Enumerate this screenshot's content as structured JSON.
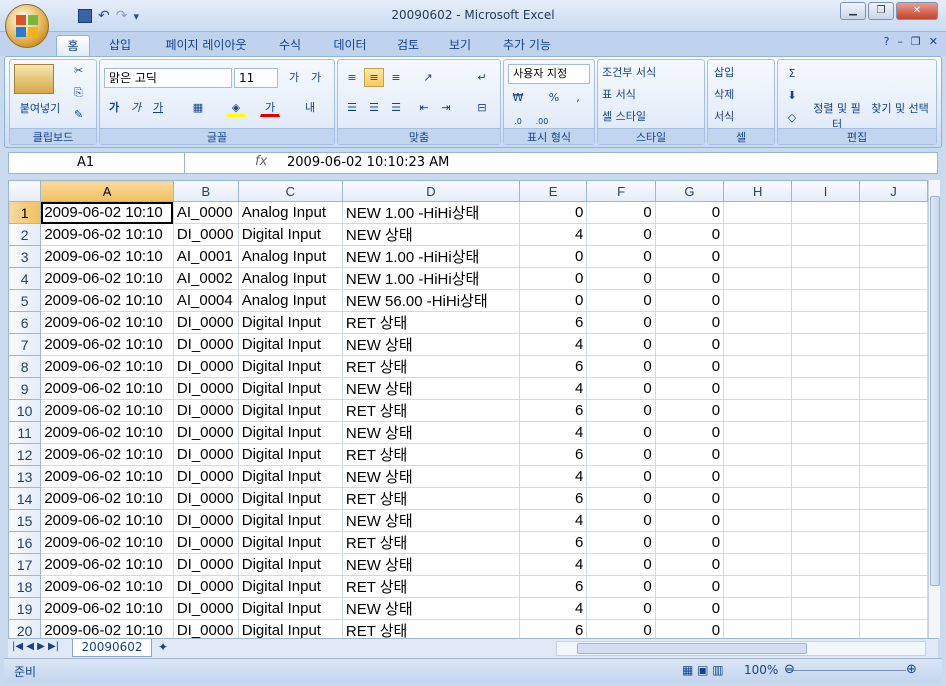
{
  "window": {
    "title": "20090602 - Microsoft Excel",
    "minimize": "▁",
    "restore": "❐",
    "close": "✕"
  },
  "ribbon_tabs": [
    "홈",
    "삽입",
    "페이지 레이아웃",
    "수식",
    "데이터",
    "검토",
    "보기",
    "추가 기능"
  ],
  "ribbon": {
    "clipboard": {
      "label": "클립보드",
      "paste": "붙여넣기"
    },
    "font": {
      "label": "글꼴",
      "name": "맑은 고딕",
      "size": "11"
    },
    "alignment": {
      "label": "맞춤"
    },
    "number": {
      "label": "표시 형식",
      "format": "사용자 지정"
    },
    "styles": {
      "label": "스타일",
      "conditional": "조건부 서식",
      "table": "표 서식",
      "cell": "셀 스타일"
    },
    "cells": {
      "label": "셀",
      "insert": "삽입",
      "delete": "삭제",
      "format": "서식"
    },
    "editing": {
      "label": "편집",
      "sort": "정렬 및 필터",
      "find": "찾기 및 선택"
    }
  },
  "formula_bar": {
    "name_box": "A1",
    "fx": "fx",
    "value": "2009-06-02  10:10:23 AM"
  },
  "columns": [
    "A",
    "B",
    "C",
    "D",
    "E",
    "F",
    "G",
    "H",
    "I",
    "J"
  ],
  "rows": [
    [
      "1",
      "2009-06-02 10:10",
      "AI_0000",
      "Analog Input",
      "NEW  1.00  -HiHi상태",
      "0",
      "0",
      "0"
    ],
    [
      "2",
      "2009-06-02 10:10",
      "DI_0000",
      "Digital Input",
      "NEW   상태",
      "4",
      "0",
      "0"
    ],
    [
      "3",
      "2009-06-02 10:10",
      "AI_0001",
      "Analog Input",
      "NEW  1.00  -HiHi상태",
      "0",
      "0",
      "0"
    ],
    [
      "4",
      "2009-06-02 10:10",
      "AI_0002",
      "Analog Input",
      "NEW  1.00  -HiHi상태",
      "0",
      "0",
      "0"
    ],
    [
      "5",
      "2009-06-02 10:10",
      "AI_0004",
      "Analog Input",
      "NEW  56.00  -HiHi상태",
      "0",
      "0",
      "0"
    ],
    [
      "6",
      "2009-06-02 10:10",
      "DI_0000",
      "Digital Input",
      "RET   상태",
      "6",
      "0",
      "0"
    ],
    [
      "7",
      "2009-06-02 10:10",
      "DI_0000",
      "Digital Input",
      "NEW   상태",
      "4",
      "0",
      "0"
    ],
    [
      "8",
      "2009-06-02 10:10",
      "DI_0000",
      "Digital Input",
      "RET   상태",
      "6",
      "0",
      "0"
    ],
    [
      "9",
      "2009-06-02 10:10",
      "DI_0000",
      "Digital Input",
      "NEW   상태",
      "4",
      "0",
      "0"
    ],
    [
      "10",
      "2009-06-02 10:10",
      "DI_0000",
      "Digital Input",
      "RET   상태",
      "6",
      "0",
      "0"
    ],
    [
      "11",
      "2009-06-02 10:10",
      "DI_0000",
      "Digital Input",
      "NEW   상태",
      "4",
      "0",
      "0"
    ],
    [
      "12",
      "2009-06-02 10:10",
      "DI_0000",
      "Digital Input",
      "RET   상태",
      "6",
      "0",
      "0"
    ],
    [
      "13",
      "2009-06-02 10:10",
      "DI_0000",
      "Digital Input",
      "NEW   상태",
      "4",
      "0",
      "0"
    ],
    [
      "14",
      "2009-06-02 10:10",
      "DI_0000",
      "Digital Input",
      "RET   상태",
      "6",
      "0",
      "0"
    ],
    [
      "15",
      "2009-06-02 10:10",
      "DI_0000",
      "Digital Input",
      "NEW   상태",
      "4",
      "0",
      "0"
    ],
    [
      "16",
      "2009-06-02 10:10",
      "DI_0000",
      "Digital Input",
      "RET   상태",
      "6",
      "0",
      "0"
    ],
    [
      "17",
      "2009-06-02 10:10",
      "DI_0000",
      "Digital Input",
      "NEW   상태",
      "4",
      "0",
      "0"
    ],
    [
      "18",
      "2009-06-02 10:10",
      "DI_0000",
      "Digital Input",
      "RET   상태",
      "6",
      "0",
      "0"
    ],
    [
      "19",
      "2009-06-02 10:10",
      "DI_0000",
      "Digital Input",
      "NEW   상태",
      "4",
      "0",
      "0"
    ],
    [
      "20",
      "2009-06-02 10:10",
      "DI_0000",
      "Digital Input",
      "RET   상태",
      "6",
      "0",
      "0"
    ]
  ],
  "sheet_tab": "20090602",
  "status": {
    "ready": "준비",
    "zoom": "100%"
  }
}
